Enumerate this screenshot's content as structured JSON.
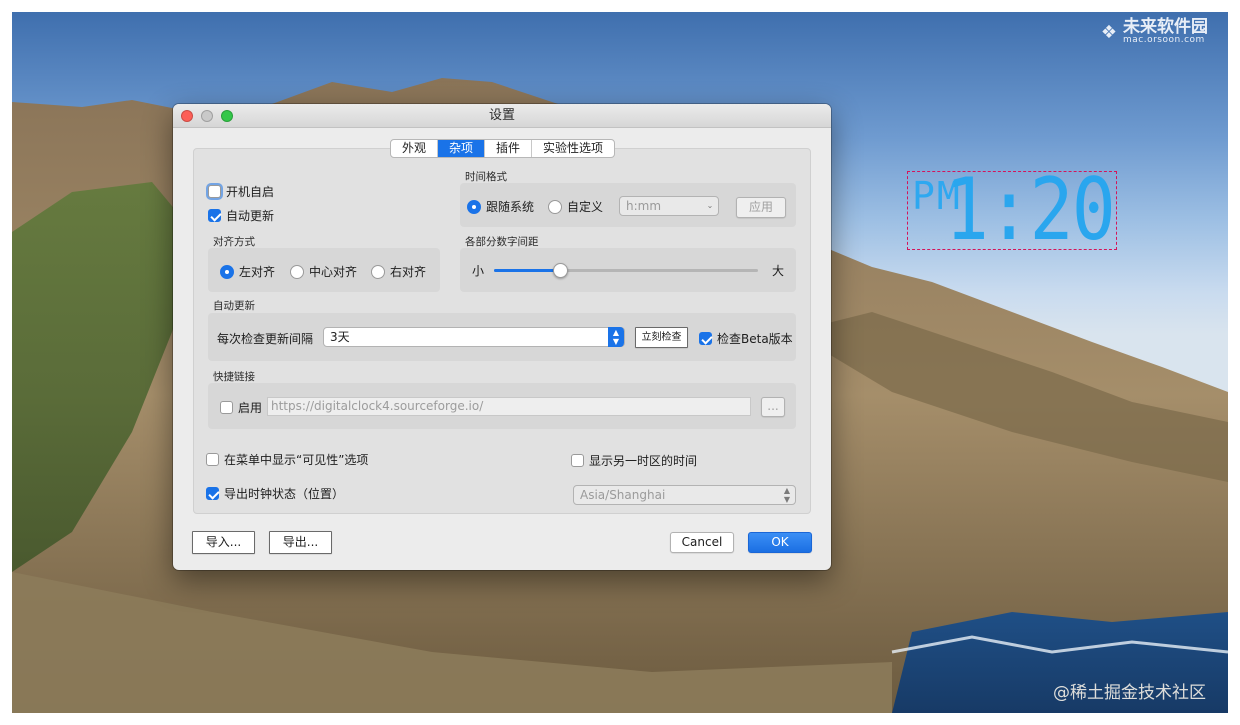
{
  "watermarks": {
    "top_brand": "未来软件园",
    "top_url": "mac.orsoon.com",
    "bottom": "@稀土掘金技术社区"
  },
  "clock": {
    "ampm": "PM",
    "time": "1:20",
    "color": "#2ea8f0",
    "border_color": "#d4145a"
  },
  "window": {
    "title": "设置",
    "traffic_lights": [
      "#fd5f57",
      "#c9c9c9",
      "#34c749"
    ],
    "tabs": [
      {
        "label": "外观",
        "active": false
      },
      {
        "label": "杂项",
        "active": true
      },
      {
        "label": "插件",
        "active": false
      },
      {
        "label": "实验性选项",
        "active": false
      }
    ],
    "startup": {
      "autostart_label": "开机自启",
      "autostart_checked": false,
      "autoupdate_label": "自动更新",
      "autoupdate_checked": true
    },
    "time_format": {
      "group_label": "时间格式",
      "system_label": "跟随系统",
      "system_selected": true,
      "custom_label": "自定义",
      "custom_selected": false,
      "format_value": "h:mm",
      "apply_label": "应用"
    },
    "alignment": {
      "group_label": "对齐方式",
      "options": [
        {
          "label": "左对齐",
          "selected": true
        },
        {
          "label": "中心对齐",
          "selected": false
        },
        {
          "label": "右对齐",
          "selected": false
        }
      ]
    },
    "spacing": {
      "group_label": "各部分数字间距",
      "min_label": "小",
      "max_label": "大",
      "value_fraction": 0.25
    },
    "update": {
      "group_label": "自动更新",
      "interval_label": "每次检查更新间隔",
      "interval_value": "3天",
      "check_now_label": "立刻检查",
      "beta_label": "检查Beta版本",
      "beta_checked": true
    },
    "quick_link": {
      "group_label": "快捷链接",
      "enable_label": "启用",
      "enable_checked": false,
      "url": "https://digitalclock4.sourceforge.io/",
      "browse_label": "..."
    },
    "options": {
      "visibility_menu_label": "在菜单中显示“可见性”选项",
      "visibility_menu_checked": false,
      "export_state_label": "导出时钟状态（位置）",
      "export_state_checked": true,
      "other_tz_label": "显示另一时区的时间",
      "other_tz_checked": false,
      "timezone_value": "Asia/Shanghai"
    },
    "footer": {
      "import_label": "导入...",
      "export_label": "导出...",
      "cancel_label": "Cancel",
      "ok_label": "OK"
    },
    "accent_color": "#1a73e8"
  }
}
